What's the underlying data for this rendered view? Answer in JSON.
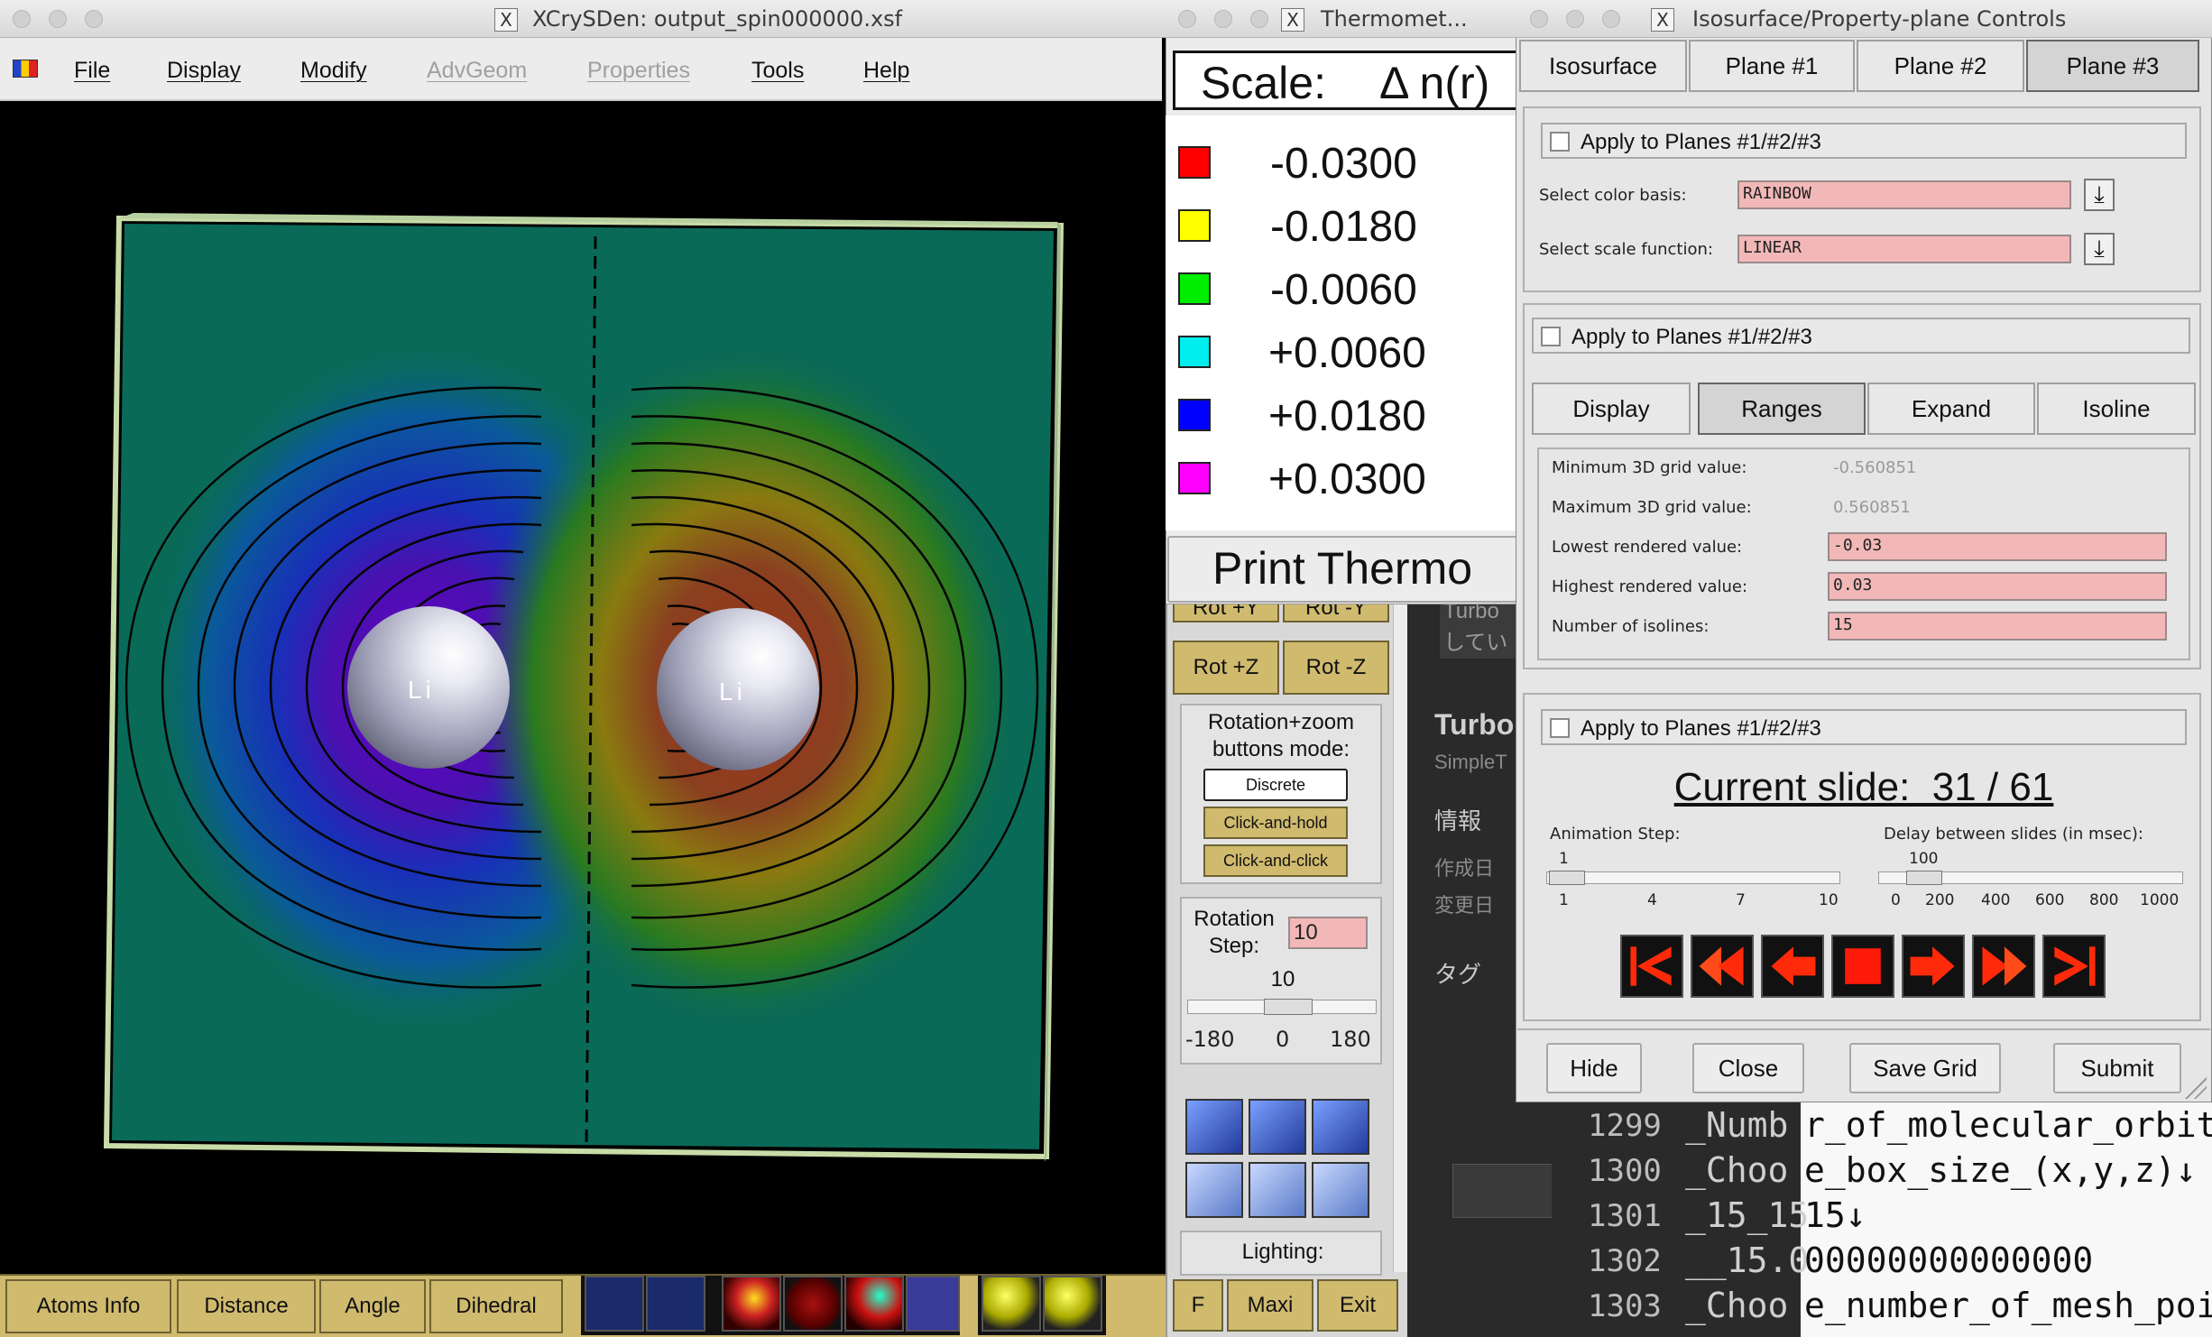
{
  "main_window": {
    "title": "XCrySDen: output_spin000000.xsf",
    "menu": [
      "File",
      "Display",
      "Modify",
      "AdvGeom",
      "Properties",
      "Tools",
      "Help"
    ],
    "atom_labels": [
      "Li",
      "Li"
    ],
    "bottom_buttons": [
      "Atoms Info",
      "Distance",
      "Angle",
      "Dihedral"
    ]
  },
  "thermometer": {
    "title": "Thermomet...",
    "scale_label": "Scale:",
    "quantity": "Δ n(r)",
    "entries": [
      {
        "value": "-0.0300",
        "color": "#ff0000"
      },
      {
        "value": "-0.0180",
        "color": "#ffff00"
      },
      {
        "value": "-0.0060",
        "color": "#00ee00"
      },
      {
        "value": "+0.0060",
        "color": "#00eeee"
      },
      {
        "value": "+0.0180",
        "color": "#0000ff"
      },
      {
        "value": "+0.0300",
        "color": "#ff00ff"
      }
    ],
    "print_button": "Print Thermo"
  },
  "side_panel": {
    "rot_buttons": [
      "Rot +Y",
      "Rot -Y",
      "Rot +Z",
      "Rot -Z"
    ],
    "mode_label": "Rotation+zoom buttons mode:",
    "modes": [
      "Discrete",
      "Click-and-hold",
      "Click-and-click"
    ],
    "rotation_step_label": "Rotation Step:",
    "rotation_step_value": "10",
    "slider_value": "10",
    "slider_ticks": [
      "-180",
      "0",
      "180"
    ],
    "lighting_label": "Lighting:",
    "bottom_buttons": [
      "F",
      "Maxi",
      "Exit"
    ]
  },
  "controls": {
    "title": "Isosurface/Property-plane Controls",
    "top_tabs": [
      "Isosurface",
      "Plane #1",
      "Plane #2",
      "Plane #3"
    ],
    "apply_label": "Apply to Planes #1/#2/#3",
    "color_basis_label": "Select color basis:",
    "color_basis_value": "RAINBOW",
    "scale_function_label": "Select scale function:",
    "scale_function_value": "LINEAR",
    "sub_tabs": [
      "Display",
      "Ranges",
      "Expand",
      "Isoline"
    ],
    "min_label": "Minimum 3D grid value:",
    "min_value": "-0.560851",
    "max_label": "Maximum 3D grid value:",
    "max_value": "0.560851",
    "lowest_label": "Lowest rendered value:",
    "lowest_value": "-0.03",
    "highest_label": "Highest rendered value:",
    "highest_value": "0.03",
    "isolines_label": "Number of isolines:",
    "isolines_value": "15",
    "current_slide": "Current slide:  31 / 61",
    "anim_step_label": "Animation Step:",
    "anim_step_value": "1",
    "anim_ticks": [
      "1",
      "4",
      "7",
      "10"
    ],
    "delay_label": "Delay between slides (in msec):",
    "delay_value": "100",
    "delay_ticks": [
      "0",
      "200",
      "400",
      "600",
      "800",
      "1000"
    ],
    "footer_buttons": [
      "Hide",
      "Close",
      "Save Grid",
      "Submit"
    ]
  },
  "background_app": {
    "heading": "Turbo",
    "sub": "SimpleT",
    "info": "情報",
    "created": "作成日",
    "modified": "変更日",
    "tags": "タグ",
    "snippet1": "Turbo",
    "snippet2": "してい",
    "line_numbers": [
      "1299",
      "1300",
      "1301",
      "1302",
      "1303"
    ],
    "code_lines": [
      "_Numb",
      "_Choo",
      "_15_15",
      "__15.0",
      "_Choo"
    ],
    "code_right": [
      "r_of_molecular_orbita",
      "e_box_size_(x,y,z)↓",
      "15↓",
      "00000000000000",
      "e_number_of_mesh_poir"
    ]
  }
}
